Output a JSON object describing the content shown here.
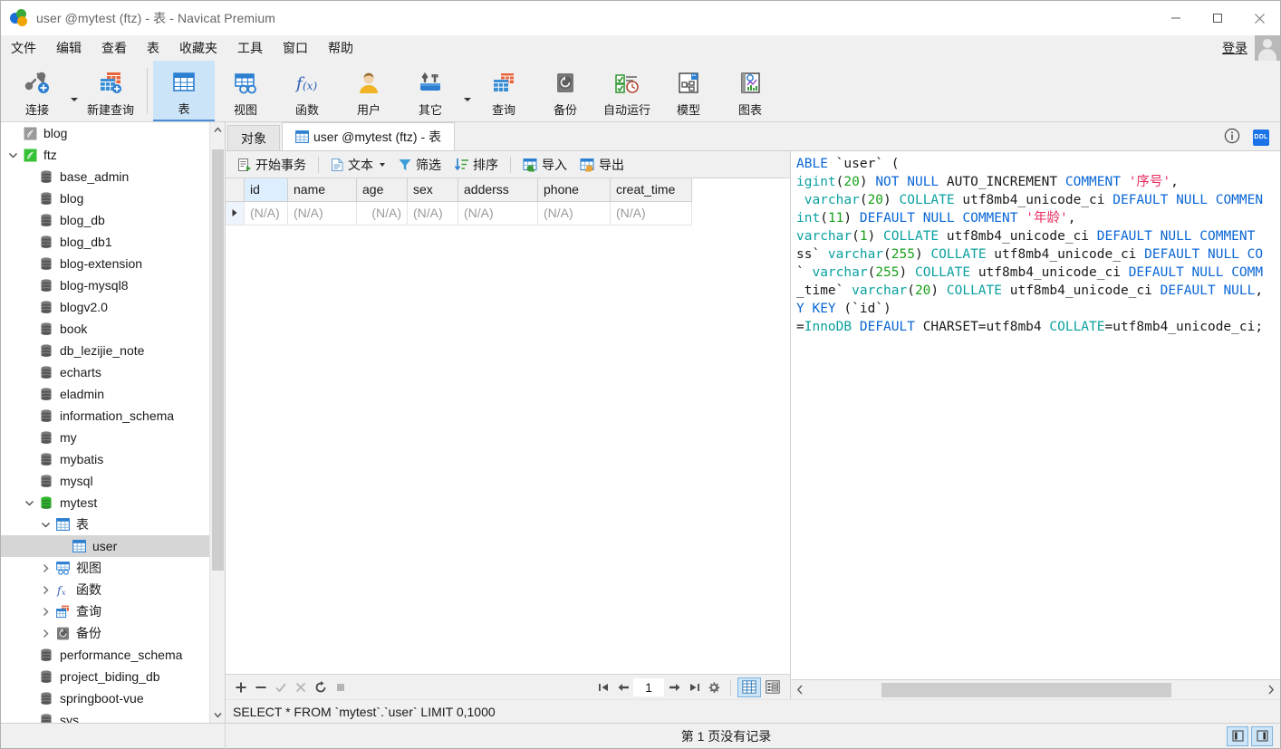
{
  "window": {
    "title": "user @mytest (ftz) - 表 - Navicat Premium",
    "minimize": "—",
    "maximize": "□",
    "close": "✕"
  },
  "menubar": {
    "items": [
      "文件",
      "编辑",
      "查看",
      "表",
      "收藏夹",
      "工具",
      "窗口",
      "帮助"
    ],
    "login_label": "登录"
  },
  "toolbar": {
    "items": [
      {
        "label": "连接",
        "icon": "connection-icon",
        "has_caret": true,
        "selected": false
      },
      {
        "label": "新建查询",
        "icon": "new-query-icon",
        "has_caret": false,
        "selected": false
      },
      {
        "label": "表",
        "icon": "table-icon",
        "has_caret": false,
        "selected": true
      },
      {
        "label": "视图",
        "icon": "view-icon",
        "has_caret": false,
        "selected": false
      },
      {
        "label": "函数",
        "icon": "function-icon",
        "has_caret": false,
        "selected": false
      },
      {
        "label": "用户",
        "icon": "user-icon",
        "has_caret": false,
        "selected": false
      },
      {
        "label": "其它",
        "icon": "other-icon",
        "has_caret": true,
        "selected": false
      },
      {
        "label": "查询",
        "icon": "query-icon",
        "has_caret": false,
        "selected": false
      },
      {
        "label": "备份",
        "icon": "backup-icon",
        "has_caret": false,
        "selected": false
      },
      {
        "label": "自动运行",
        "icon": "automation-icon",
        "has_caret": false,
        "selected": false
      },
      {
        "label": "模型",
        "icon": "model-icon",
        "has_caret": false,
        "selected": false
      },
      {
        "label": "图表",
        "icon": "chart-icon",
        "has_caret": false,
        "selected": false
      }
    ]
  },
  "sidebar": {
    "items": [
      {
        "label": "blog",
        "icon": "connection-icon",
        "indent": 0,
        "twisty": "none",
        "selected": false,
        "conn_color": "#9a9a9a"
      },
      {
        "label": "ftz",
        "icon": "connection-icon",
        "indent": 0,
        "twisty": "expanded",
        "selected": false,
        "conn_color": "#35c135"
      },
      {
        "label": "base_admin",
        "icon": "schema-icon",
        "indent": 1,
        "twisty": "none",
        "selected": false
      },
      {
        "label": "blog",
        "icon": "schema-icon",
        "indent": 1,
        "twisty": "none",
        "selected": false
      },
      {
        "label": "blog_db",
        "icon": "schema-icon",
        "indent": 1,
        "twisty": "none",
        "selected": false
      },
      {
        "label": "blog_db1",
        "icon": "schema-icon",
        "indent": 1,
        "twisty": "none",
        "selected": false
      },
      {
        "label": "blog-extension",
        "icon": "schema-icon",
        "indent": 1,
        "twisty": "none",
        "selected": false
      },
      {
        "label": "blog-mysql8",
        "icon": "schema-icon",
        "indent": 1,
        "twisty": "none",
        "selected": false
      },
      {
        "label": "blogv2.0",
        "icon": "schema-icon",
        "indent": 1,
        "twisty": "none",
        "selected": false
      },
      {
        "label": "book",
        "icon": "schema-icon",
        "indent": 1,
        "twisty": "none",
        "selected": false
      },
      {
        "label": "db_lezijie_note",
        "icon": "schema-icon",
        "indent": 1,
        "twisty": "none",
        "selected": false
      },
      {
        "label": "echarts",
        "icon": "schema-icon",
        "indent": 1,
        "twisty": "none",
        "selected": false
      },
      {
        "label": "eladmin",
        "icon": "schema-icon",
        "indent": 1,
        "twisty": "none",
        "selected": false
      },
      {
        "label": "information_schema",
        "icon": "schema-icon",
        "indent": 1,
        "twisty": "none",
        "selected": false
      },
      {
        "label": "my",
        "icon": "schema-icon",
        "indent": 1,
        "twisty": "none",
        "selected": false
      },
      {
        "label": "mybatis",
        "icon": "schema-icon",
        "indent": 1,
        "twisty": "none",
        "selected": false
      },
      {
        "label": "mysql",
        "icon": "schema-icon",
        "indent": 1,
        "twisty": "none",
        "selected": false
      },
      {
        "label": "mytest",
        "icon": "schema-icon-open",
        "indent": 1,
        "twisty": "expanded",
        "selected": false
      },
      {
        "label": "表",
        "icon": "tables-folder-icon",
        "indent": 2,
        "twisty": "expanded",
        "selected": false
      },
      {
        "label": "user",
        "icon": "table-item-icon",
        "indent": 3,
        "twisty": "none",
        "selected": true
      },
      {
        "label": "视图",
        "icon": "views-folder-icon",
        "indent": 2,
        "twisty": "collapsed",
        "selected": false
      },
      {
        "label": "函数",
        "icon": "functions-folder-icon",
        "indent": 2,
        "twisty": "collapsed",
        "selected": false
      },
      {
        "label": "查询",
        "icon": "queries-folder-icon",
        "indent": 2,
        "twisty": "collapsed",
        "selected": false
      },
      {
        "label": "备份",
        "icon": "backups-folder-icon",
        "indent": 2,
        "twisty": "collapsed",
        "selected": false
      },
      {
        "label": "performance_schema",
        "icon": "schema-icon",
        "indent": 1,
        "twisty": "none",
        "selected": false
      },
      {
        "label": "project_biding_db",
        "icon": "schema-icon",
        "indent": 1,
        "twisty": "none",
        "selected": false
      },
      {
        "label": "springboot-vue",
        "icon": "schema-icon",
        "indent": 1,
        "twisty": "none",
        "selected": false
      },
      {
        "label": "sys",
        "icon": "schema-icon",
        "indent": 1,
        "twisty": "none",
        "selected": false
      }
    ]
  },
  "tabs": {
    "objects_tab": "对象",
    "active_tab": "user @mytest (ftz) - 表"
  },
  "grid_toolbar": {
    "begin_transaction": "开始事务",
    "text": "文本",
    "filter": "筛选",
    "sort": "排序",
    "import": "导入",
    "export": "导出"
  },
  "grid": {
    "columns": [
      "id",
      "name",
      "age",
      "sex",
      "adderss",
      "phone",
      "creat_time"
    ],
    "rows": [
      [
        "(N/A)",
        "(N/A)",
        "(N/A)",
        "(N/A)",
        "(N/A)",
        "(N/A)",
        "(N/A)"
      ]
    ],
    "selected_column": "id"
  },
  "grid_footer": {
    "page_value": "1"
  },
  "sql_preview": "SELECT * FROM `mytest`.`user` LIMIT 0,1000",
  "ddl": {
    "lines": [
      [
        {
          "t": "ABLE ",
          "c": "k"
        },
        {
          "t": "`user`",
          "c": "p"
        },
        {
          "t": " (",
          "c": "p"
        }
      ],
      [
        {
          "t": "igint",
          "c": "t"
        },
        {
          "t": "(",
          "c": "p"
        },
        {
          "t": "20",
          "c": "n"
        },
        {
          "t": ") ",
          "c": "p"
        },
        {
          "t": "NOT NULL",
          "c": "k"
        },
        {
          "t": " AUTO_INCREMENT ",
          "c": "p"
        },
        {
          "t": "COMMENT",
          "c": "k"
        },
        {
          "t": " ",
          "c": "p"
        },
        {
          "t": "'序号'",
          "c": "s"
        },
        {
          "t": ",",
          "c": "p"
        }
      ],
      [
        {
          "t": " ",
          "c": "p"
        },
        {
          "t": "varchar",
          "c": "t"
        },
        {
          "t": "(",
          "c": "p"
        },
        {
          "t": "20",
          "c": "n"
        },
        {
          "t": ") ",
          "c": "p"
        },
        {
          "t": "COLLATE",
          "c": "t"
        },
        {
          "t": " utf8mb4_unicode_ci ",
          "c": "p"
        },
        {
          "t": "DEFAULT NULL COMMEN",
          "c": "k"
        }
      ],
      [
        {
          "t": "int",
          "c": "t"
        },
        {
          "t": "(",
          "c": "p"
        },
        {
          "t": "11",
          "c": "n"
        },
        {
          "t": ") ",
          "c": "p"
        },
        {
          "t": "DEFAULT NULL COMMENT",
          "c": "k"
        },
        {
          "t": " ",
          "c": "p"
        },
        {
          "t": "'年龄'",
          "c": "s"
        },
        {
          "t": ",",
          "c": "p"
        }
      ],
      [
        {
          "t": "varchar",
          "c": "t"
        },
        {
          "t": "(",
          "c": "p"
        },
        {
          "t": "1",
          "c": "n"
        },
        {
          "t": ") ",
          "c": "p"
        },
        {
          "t": "COLLATE",
          "c": "t"
        },
        {
          "t": " utf8mb4_unicode_ci ",
          "c": "p"
        },
        {
          "t": "DEFAULT NULL COMMENT",
          "c": "k"
        }
      ],
      [
        {
          "t": "ss` ",
          "c": "p"
        },
        {
          "t": "varchar",
          "c": "t"
        },
        {
          "t": "(",
          "c": "p"
        },
        {
          "t": "255",
          "c": "n"
        },
        {
          "t": ") ",
          "c": "p"
        },
        {
          "t": "COLLATE",
          "c": "t"
        },
        {
          "t": " utf8mb4_unicode_ci ",
          "c": "p"
        },
        {
          "t": "DEFAULT NULL CO",
          "c": "k"
        }
      ],
      [
        {
          "t": "` ",
          "c": "p"
        },
        {
          "t": "varchar",
          "c": "t"
        },
        {
          "t": "(",
          "c": "p"
        },
        {
          "t": "255",
          "c": "n"
        },
        {
          "t": ") ",
          "c": "p"
        },
        {
          "t": "COLLATE",
          "c": "t"
        },
        {
          "t": " utf8mb4_unicode_ci ",
          "c": "p"
        },
        {
          "t": "DEFAULT NULL COMM",
          "c": "k"
        }
      ],
      [
        {
          "t": "_time` ",
          "c": "p"
        },
        {
          "t": "varchar",
          "c": "t"
        },
        {
          "t": "(",
          "c": "p"
        },
        {
          "t": "20",
          "c": "n"
        },
        {
          "t": ") ",
          "c": "p"
        },
        {
          "t": "COLLATE",
          "c": "t"
        },
        {
          "t": " utf8mb4_unicode_ci ",
          "c": "p"
        },
        {
          "t": "DEFAULT NULL",
          "c": "k"
        },
        {
          "t": ",",
          "c": "p"
        }
      ],
      [
        {
          "t": "Y KEY",
          "c": "k"
        },
        {
          "t": " (`id`)",
          "c": "p"
        }
      ],
      [
        {
          "t": "=",
          "c": "p"
        },
        {
          "t": "InnoDB",
          "c": "t"
        },
        {
          "t": " ",
          "c": "p"
        },
        {
          "t": "DEFAULT",
          "c": "k"
        },
        {
          "t": " CHARSET=utf8mb4 ",
          "c": "p"
        },
        {
          "t": "COLLATE",
          "c": "t"
        },
        {
          "t": "=utf8mb4_unicode_ci;",
          "c": "p"
        }
      ]
    ]
  },
  "statusbar": {
    "message": "第 1 页没有记录"
  },
  "colors": {
    "accent": "#1a73e8",
    "selection": "#cce4f7",
    "tree_selection": "#d6d6d6",
    "chrome": "#f0f0f0"
  }
}
